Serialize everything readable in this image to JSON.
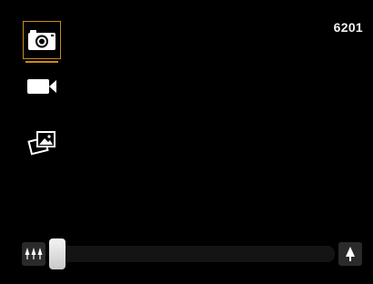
{
  "status": {
    "shots_remaining": "6201"
  },
  "modes": [
    {
      "name": "camera",
      "icon": "camera-icon",
      "selected": true
    },
    {
      "name": "video",
      "icon": "video-camera-icon",
      "selected": false
    },
    {
      "name": "gallery",
      "icon": "photo-gallery-icon",
      "selected": false
    }
  ],
  "zoom": {
    "out_icon": "trees-icon",
    "in_icon": "tree-icon",
    "level": 0.0
  },
  "colors": {
    "background": "#000000",
    "selection": "#c98a1a",
    "icon": "#ffffff"
  }
}
